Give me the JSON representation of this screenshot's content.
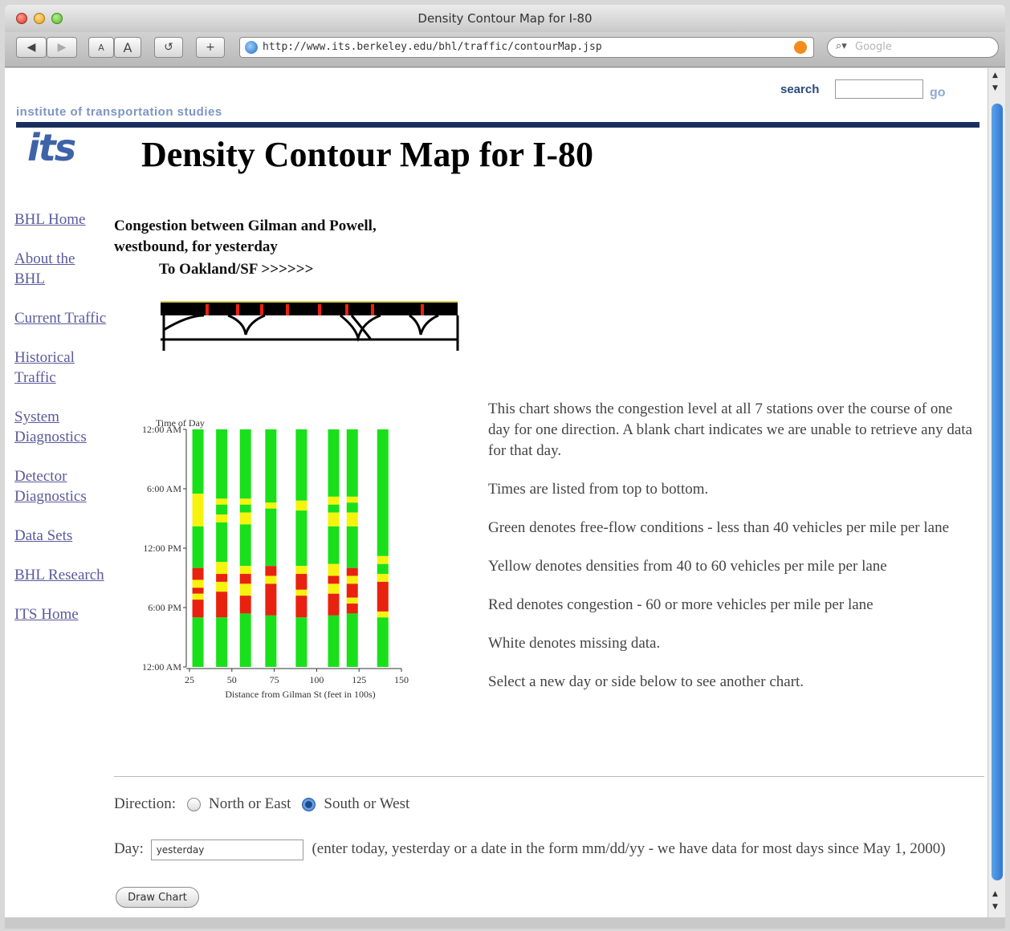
{
  "window": {
    "title": "Density Contour Map for I-80"
  },
  "toolbar": {
    "back_label": "◀",
    "forward_label": "▶",
    "font_small_label": "A",
    "font_large_label": "A",
    "reload_label": "↺",
    "add_label": "+",
    "url": "http://www.its.berkeley.edu/bhl/traffic/contourMap.jsp",
    "search_placeholder": "Google"
  },
  "header": {
    "search_label": "search",
    "go_label": "go",
    "institute": "institute of transportation studies",
    "logo": "its",
    "page_title": "Density Contour Map for I-80"
  },
  "nav": [
    "BHL Home",
    "About the BHL",
    "Current Traffic",
    "Historical Traffic",
    "System Diagnostics",
    "Detector Diagnostics",
    "Data Sets",
    "BHL Research",
    "ITS Home"
  ],
  "main": {
    "caption_line1": "Congestion between Gilman and Powell,",
    "caption_line2": "westbound, for yesterday",
    "direction_label": "To Oakland/SF >>>>>>",
    "description": [
      "This chart shows the congestion level at all 7 stations over the course of one day for one direction. A blank chart indicates we are unable to retrieve any data for that day.",
      "Times are listed from top to bottom.",
      "Green denotes free-flow conditions - less than 40 vehicles per mile per lane",
      "Yellow denotes densities from 40 to 60 vehicles per mile per lane",
      "Red denotes congestion - 60 or more vehicles per mile per lane",
      "White denotes missing data.",
      "Select a new day or side below to see another chart."
    ]
  },
  "form": {
    "direction_label": "Direction:",
    "options": [
      {
        "label": "North or East",
        "checked": false
      },
      {
        "label": "South or West",
        "checked": true
      }
    ],
    "day_label": "Day:",
    "day_value": "yesterday",
    "day_hint": "(enter today, yesterday or a date in the form mm/dd/yy - we have data for most days since May 1, 2000)",
    "submit_label": "Draw Chart"
  },
  "chart_data": {
    "type": "heatmap",
    "title": "Time of Day",
    "xlabel": "Distance from Gilman St (feet in 100s)",
    "ylabel": "Time of Day",
    "x_ticks": [
      25,
      50,
      75,
      100,
      125,
      150
    ],
    "y_ticks": [
      "12:00 AM",
      "6:00 AM",
      "12:00 PM",
      "6:00 PM",
      "12:00 AM"
    ],
    "xlim": [
      25,
      150
    ],
    "ylim_hours": [
      0,
      24
    ],
    "colors": {
      "green": "#19e01a",
      "yellow": "#f6f30c",
      "red": "#e8220f"
    },
    "stations": [
      {
        "x": 30,
        "segments": [
          [
            0,
            6.5,
            "green"
          ],
          [
            6.5,
            7.3,
            "yellow"
          ],
          [
            7.3,
            9.8,
            "yellow"
          ],
          [
            9.8,
            14,
            "green"
          ],
          [
            14,
            15.2,
            "red"
          ],
          [
            15.2,
            16,
            "yellow"
          ],
          [
            16,
            16.6,
            "red"
          ],
          [
            16.6,
            17.2,
            "yellow"
          ],
          [
            17.2,
            19,
            "red"
          ],
          [
            19,
            24,
            "green"
          ]
        ]
      },
      {
        "x": 44,
        "segments": [
          [
            0,
            7,
            "green"
          ],
          [
            7,
            7.6,
            "yellow"
          ],
          [
            7.6,
            8.6,
            "green"
          ],
          [
            8.6,
            9.4,
            "yellow"
          ],
          [
            9.4,
            13.4,
            "green"
          ],
          [
            13.4,
            14.6,
            "yellow"
          ],
          [
            14.6,
            15.4,
            "red"
          ],
          [
            15.4,
            16.4,
            "yellow"
          ],
          [
            16.4,
            19,
            "red"
          ],
          [
            19,
            24,
            "green"
          ]
        ]
      },
      {
        "x": 58,
        "segments": [
          [
            0,
            7,
            "green"
          ],
          [
            7,
            7.6,
            "yellow"
          ],
          [
            7.6,
            8.4,
            "green"
          ],
          [
            8.4,
            9.6,
            "yellow"
          ],
          [
            9.6,
            13.8,
            "green"
          ],
          [
            13.8,
            14.6,
            "yellow"
          ],
          [
            14.6,
            15.6,
            "red"
          ],
          [
            15.6,
            16.8,
            "yellow"
          ],
          [
            16.8,
            18.6,
            "red"
          ],
          [
            18.6,
            24,
            "green"
          ]
        ]
      },
      {
        "x": 73,
        "segments": [
          [
            0,
            7.4,
            "green"
          ],
          [
            7.4,
            8,
            "yellow"
          ],
          [
            8,
            13.8,
            "green"
          ],
          [
            13.8,
            14.8,
            "red"
          ],
          [
            14.8,
            15.6,
            "yellow"
          ],
          [
            15.6,
            18.8,
            "red"
          ],
          [
            18.8,
            24,
            "green"
          ]
        ]
      },
      {
        "x": 91,
        "segments": [
          [
            0,
            7.2,
            "green"
          ],
          [
            7.2,
            8.2,
            "yellow"
          ],
          [
            8.2,
            13.8,
            "green"
          ],
          [
            13.8,
            14.6,
            "yellow"
          ],
          [
            14.6,
            16.2,
            "red"
          ],
          [
            16.2,
            16.8,
            "yellow"
          ],
          [
            16.8,
            19,
            "red"
          ],
          [
            19,
            24,
            "green"
          ]
        ]
      },
      {
        "x": 110,
        "segments": [
          [
            0,
            6.8,
            "green"
          ],
          [
            6.8,
            7.6,
            "yellow"
          ],
          [
            7.6,
            8.4,
            "green"
          ],
          [
            8.4,
            9.8,
            "yellow"
          ],
          [
            9.8,
            13.6,
            "green"
          ],
          [
            13.6,
            14.8,
            "yellow"
          ],
          [
            14.8,
            15.6,
            "red"
          ],
          [
            15.6,
            16.6,
            "yellow"
          ],
          [
            16.6,
            18.8,
            "red"
          ],
          [
            18.8,
            24,
            "green"
          ]
        ]
      },
      {
        "x": 121,
        "segments": [
          [
            0,
            6.8,
            "green"
          ],
          [
            6.8,
            7.4,
            "yellow"
          ],
          [
            7.4,
            8.4,
            "green"
          ],
          [
            8.4,
            9.8,
            "yellow"
          ],
          [
            9.8,
            14,
            "green"
          ],
          [
            14,
            14.8,
            "red"
          ],
          [
            14.8,
            15.6,
            "yellow"
          ],
          [
            15.6,
            17,
            "red"
          ],
          [
            17,
            17.6,
            "yellow"
          ],
          [
            17.6,
            18.6,
            "red"
          ],
          [
            18.6,
            24,
            "green"
          ]
        ]
      },
      {
        "x": 139,
        "segments": [
          [
            0,
            12.8,
            "green"
          ],
          [
            12.8,
            13.6,
            "yellow"
          ],
          [
            13.6,
            14.6,
            "green"
          ],
          [
            14.6,
            15.4,
            "yellow"
          ],
          [
            15.4,
            18.4,
            "red"
          ],
          [
            18.4,
            19,
            "yellow"
          ],
          [
            19,
            24,
            "green"
          ]
        ]
      }
    ]
  }
}
